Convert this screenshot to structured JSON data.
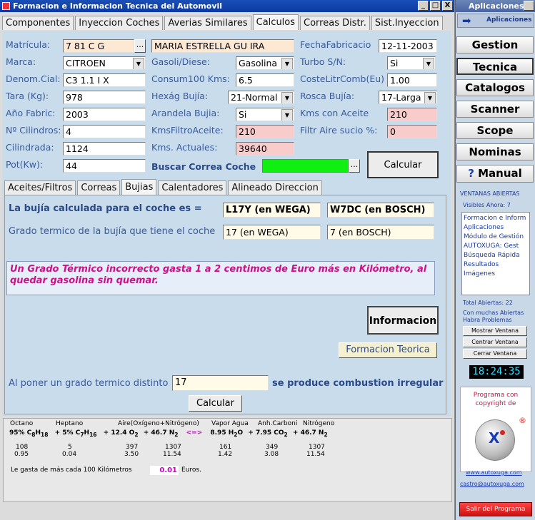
{
  "window": {
    "title": "Formacion e Informacion Tecnica del Automovil",
    "min": "_",
    "max": "□",
    "close": "X"
  },
  "main_tabs": [
    "Componentes",
    "Inyeccion Coches",
    "Averias Similares",
    "Calculos",
    "Correas Distr.",
    "Sist.Inyeccion"
  ],
  "form": {
    "matricula_label": "Matrícula:",
    "matricula": "7  81 C  G",
    "owner": "MARIA ESTRELLA    GU  IRA",
    "fecha_label": "FechaFabricacio",
    "fecha": "12-11-2003",
    "marca_label": "Marca:",
    "marca": "CITROEN",
    "gasoli_label": "Gasoli/Diese:",
    "gasoli": "Gasolina",
    "turbo_label": "Turbo S/N:",
    "turbo": "Si",
    "denom_label": "Denom.Cial:",
    "denom": "C3 1.1 I X",
    "consum_label": "Consum100 Kms:",
    "consum": "6.5",
    "coste_label": "CosteLitrComb(Eu)",
    "coste": "1.00",
    "tara_label": "Tara (Kg):",
    "tara": "978",
    "hexag_label": "Hexág Bujía:",
    "hexag": "21-Normal",
    "rosca_label": "Rosca Bujía:",
    "rosca": "17-Larga",
    "anio_label": "Año Fabric:",
    "anio": "2003",
    "arandela_label": "Arandela Bujia:",
    "arandela": "Si",
    "kmsaceite_label": "Kms con Aceite",
    "kmsaceite": "210",
    "cil_label": "Nº Cilindros:",
    "cil": "4",
    "kmsfiltro_label": "KmsFiltroAceite:",
    "kmsfiltro": "210",
    "filtro_label": "Filtr Aire sucio %:",
    "filtro": "0",
    "cilindrada_label": "Cilindrada:",
    "cilindrada": "1124",
    "kmsact_label": "Kms. Actuales:",
    "kmsact": "39640",
    "pot_label": "Pot(Kw):",
    "pot": "44",
    "buscar_label": "Buscar Correa Coche",
    "calcular": "Calcular",
    "browse": "..."
  },
  "sub_tabs": [
    "Aceites/Filtros",
    "Correas",
    "Bujias",
    "Calentadores",
    "Alineado Direccion"
  ],
  "bujias": {
    "calc_label": "La bujía calculada para el coche es =",
    "wega": "L17Y (en WEGA)",
    "bosch": "W7DC (en BOSCH)",
    "grado_label": "Grado termico de la bujía que tiene el coche",
    "grado_wega": "17 (en WEGA)",
    "grado_bosch": "7 (en BOSCH)",
    "warning": "Un Grado Térmico incorrecto gasta 1 a 2 centimos de Euro más en Kilómetro, al quedar gasolina sin quemar.",
    "informacion": "Informacion",
    "formacion": "Formacion Teorica",
    "poner_label": "Al poner un grado termico distinto",
    "poner_value": "17",
    "combustion": "se produce combustion irregular",
    "calcular": "Calcular"
  },
  "chem": {
    "h_octano": "Octano",
    "h_heptano": "Heptano",
    "h_aire": "Aire(Oxígeno+Nitrógeno)",
    "h_vapor": "Vapor Agua",
    "h_anh": "Anh.Carboni",
    "h_nitro": "Nitrógeno",
    "f1": "95% C",
    "f1s1": "8",
    "f1b": "H",
    "f1s2": "18",
    "f2": "+ 5% C",
    "f2s1": "7",
    "f2b": "H",
    "f2s2": "16",
    "f3": "+ 12.4 O",
    "f3s": "2",
    "f4": "+ 46.7 N",
    "f4s": "2",
    "arrow": "<=>",
    "f5": "8.95 H",
    "f5s": "2",
    "f5b": "O",
    "f6": "+ 7.95 CO",
    "f6s": "2",
    "f7": "+ 46.7 N",
    "f7s": "2",
    "r1": [
      "108",
      "5",
      "397",
      "1307",
      "161",
      "349",
      "1307"
    ],
    "r2": [
      "0.95",
      "0.04",
      "3.50",
      "11.54",
      "1.42",
      "3.08",
      "11.54"
    ],
    "gasta_label": "Le gasta de más cada 100 Kilómetros",
    "gasta_value": "0.01",
    "euros": "Euros."
  },
  "side": {
    "title": "Aplicaciones",
    "header": "Aplicaciones",
    "buttons": [
      "Gestion",
      "Tecnica",
      "Catalogos",
      "Scanner",
      "Scope",
      "Nominas",
      "Manual"
    ],
    "manual_q": "?",
    "ventanas": "VENTANAS ABIERTAS",
    "visibles": "Visibles Ahora: 7",
    "list": [
      "Formacion e Inform",
      "Aplicaciones",
      "Módulo de Gestión",
      "AUTOXUGA:  Gest",
      "Búsqueda Rápida",
      "Resultados",
      "Imágenes"
    ],
    "total": "Total Abiertas: 22",
    "muchas": "Con muchas Abiertas",
    "problemas": "Habra Problemas",
    "mostrar": "Mostrar Ventana",
    "centrar": "Centrar Ventana",
    "cerrar": "Cerrar Ventana",
    "clock": "18:24:35",
    "copyright": "Programa con copyright de",
    "reg": "®",
    "logo_text": "X",
    "web": "www.autoxuga.com",
    "email": "castro@autoxuga.com",
    "salir": "Salir del Programa"
  }
}
